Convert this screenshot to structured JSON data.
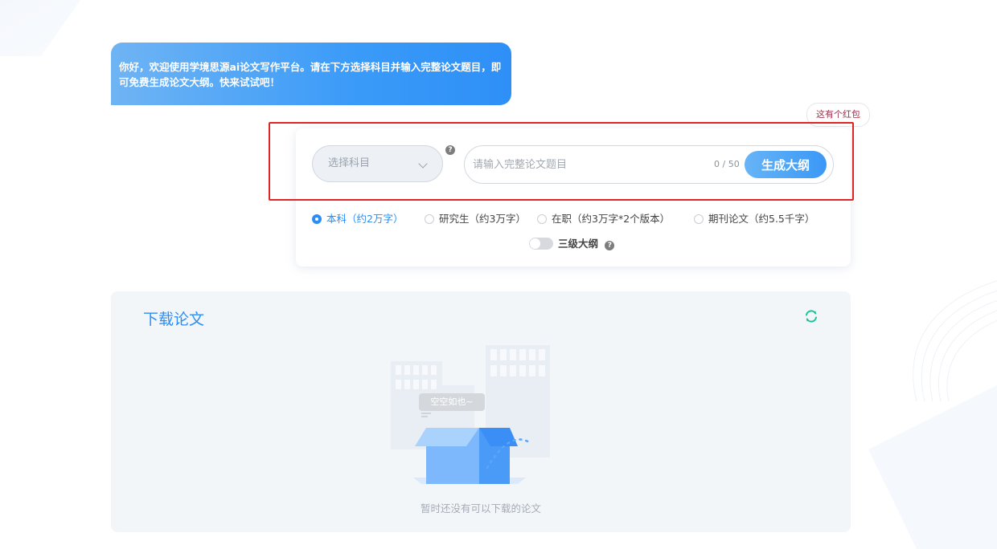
{
  "greeting": {
    "text": "你好，欢迎使用学境思源ai论文写作平台。请在下方选择科目并输入完整论文题目，即可免费生成论文大纲。快来试试吧！"
  },
  "red_packet": {
    "label": "这有个红包",
    "icon": "red-packet-icon"
  },
  "form": {
    "subject_select": {
      "value": "选择科目",
      "icon": "chevron-down-icon"
    },
    "help_glyph": "?",
    "title_input": {
      "placeholder": "请输入完整论文题目",
      "value": ""
    },
    "char_count": "0 / 50",
    "generate_label": "生成大纲",
    "paper_types": [
      {
        "label": "本科（约2万字）",
        "selected": true
      },
      {
        "label": "研究生（约3万字）",
        "selected": false
      },
      {
        "label": "在职（约3万字*2个版本）",
        "selected": false
      },
      {
        "label": "期刊论文（约5.5千字）",
        "selected": false
      }
    ],
    "outline_toggle": {
      "label": "三级大纲",
      "on": false
    }
  },
  "download": {
    "title": "下载论文",
    "refresh_icon": "refresh-icon",
    "empty_bubble": "空空如也~",
    "empty_text": "暂时还没有可以下载的论文"
  },
  "colors": {
    "accent": "#2b8df5",
    "highlight_border": "#e02424",
    "refresh": "#16c39a",
    "red_packet": "#e8353b"
  }
}
